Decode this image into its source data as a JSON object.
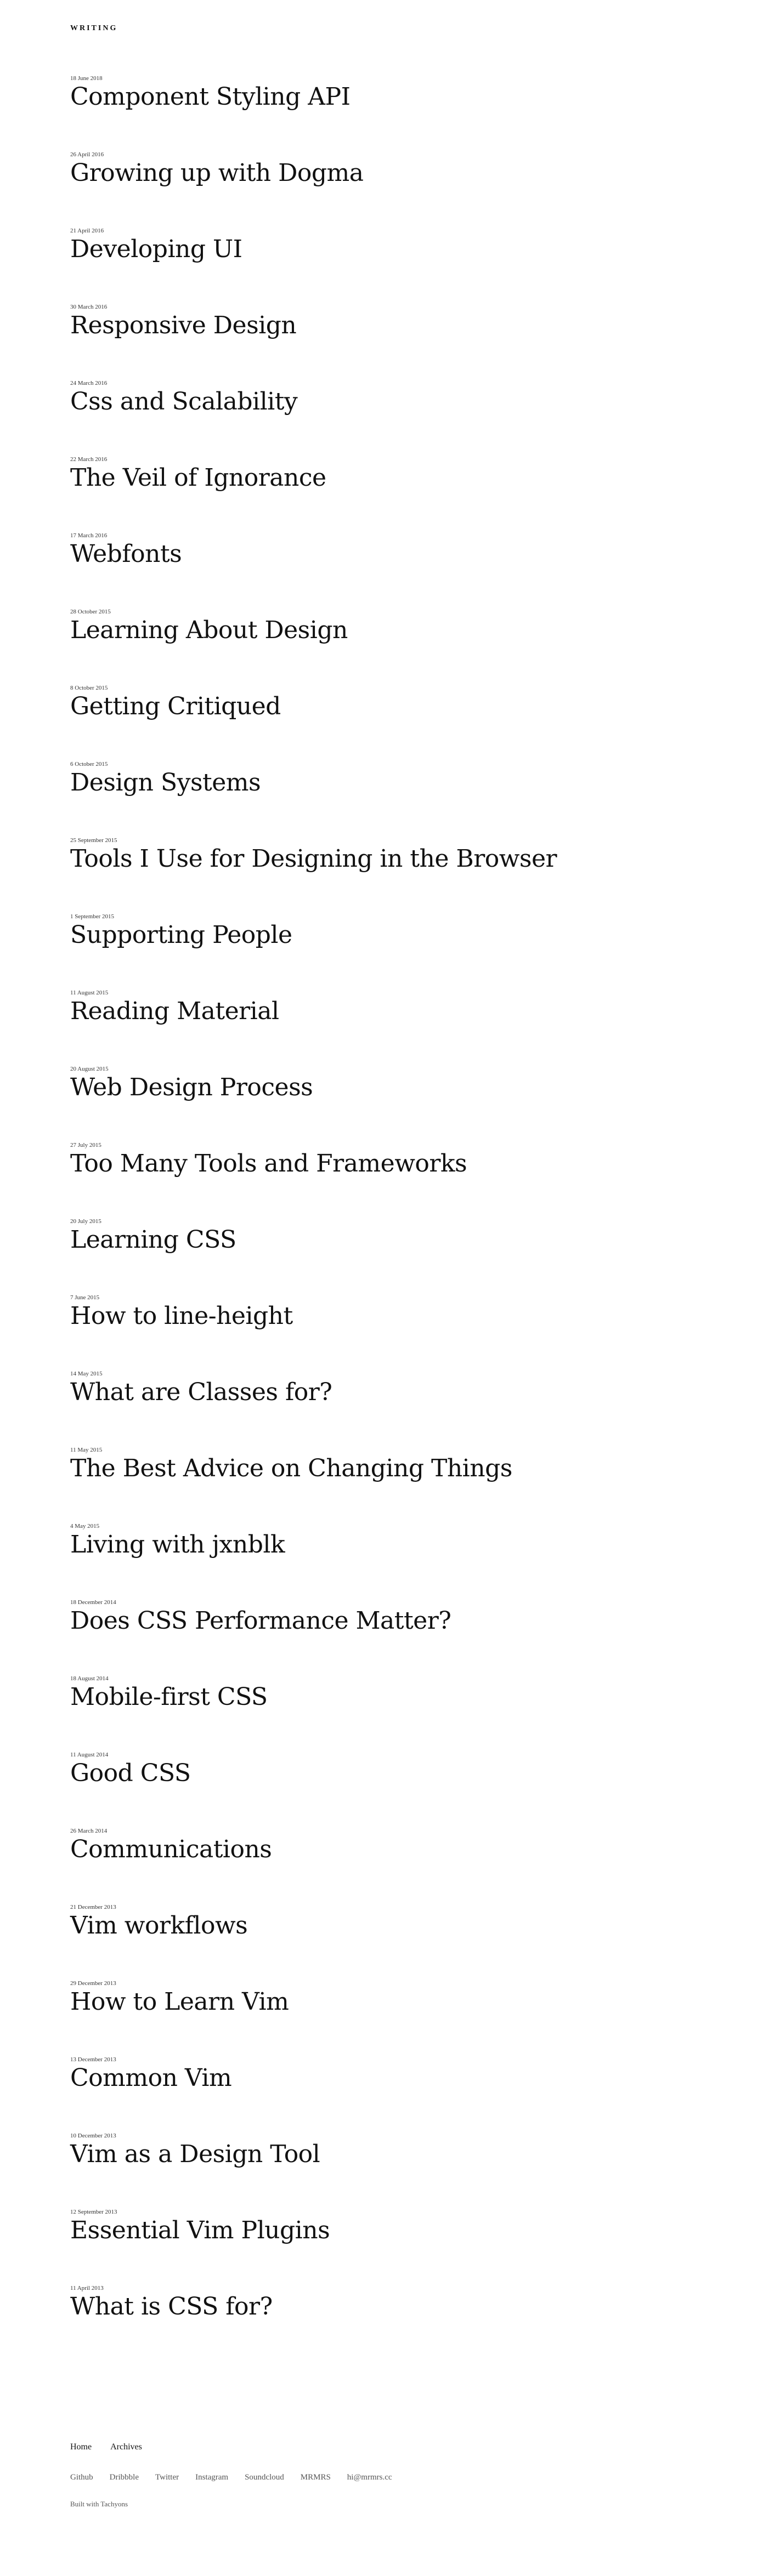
{
  "header": {
    "title": "WRITING"
  },
  "posts": [
    {
      "date": "18 June 2018",
      "title": "Component Styling API"
    },
    {
      "date": "26 April 2016",
      "title": "Growing up with Dogma"
    },
    {
      "date": "21 April 2016",
      "title": "Developing UI"
    },
    {
      "date": "30 March 2016",
      "title": "Responsive Design"
    },
    {
      "date": "24 March 2016",
      "title": "Css and Scalability"
    },
    {
      "date": "22 March 2016",
      "title": "The Veil of Ignorance"
    },
    {
      "date": "17 March 2016",
      "title": "Webfonts"
    },
    {
      "date": "28 October 2015",
      "title": "Learning About Design"
    },
    {
      "date": "8 October 2015",
      "title": "Getting Critiqued"
    },
    {
      "date": "6 October 2015",
      "title": "Design Systems"
    },
    {
      "date": "25 September 2015",
      "title": "Tools I Use for Designing in the Browser"
    },
    {
      "date": "1 September 2015",
      "title": "Supporting People"
    },
    {
      "date": "11 August 2015",
      "title": "Reading Material"
    },
    {
      "date": "20 August 2015",
      "title": "Web Design Process"
    },
    {
      "date": "27 July 2015",
      "title": "Too Many Tools and Frameworks"
    },
    {
      "date": "20 July 2015",
      "title": "Learning CSS"
    },
    {
      "date": "7 June 2015",
      "title": "How to line-height"
    },
    {
      "date": "14 May 2015",
      "title": "What are Classes for?"
    },
    {
      "date": "11 May 2015",
      "title": "The Best Advice on Changing Things"
    },
    {
      "date": "4 May 2015",
      "title": "Living with jxnblk"
    },
    {
      "date": "18 December 2014",
      "title": "Does CSS Performance Matter?"
    },
    {
      "date": "18 August 2014",
      "title": "Mobile-first CSS"
    },
    {
      "date": "11 August 2014",
      "title": "Good CSS"
    },
    {
      "date": "26 March 2014",
      "title": "Communications"
    },
    {
      "date": "21 December 2013",
      "title": "Vim workflows"
    },
    {
      "date": "29 December 2013",
      "title": "How to Learn Vim"
    },
    {
      "date": "13 December 2013",
      "title": "Common Vim"
    },
    {
      "date": "10 December 2013",
      "title": "Vim as a Design Tool"
    },
    {
      "date": "12 September 2013",
      "title": "Essential Vim Plugins"
    },
    {
      "date": "11 April 2013",
      "title": "What is CSS for?"
    }
  ],
  "footer": {
    "nav": [
      "Home",
      "Archives"
    ],
    "social": [
      "Github",
      "Dribbble",
      "Twitter",
      "Instagram",
      "Soundcloud",
      "MRMRS",
      "hi@mrmrs.cc"
    ],
    "credit": "Built with Tachyons"
  }
}
